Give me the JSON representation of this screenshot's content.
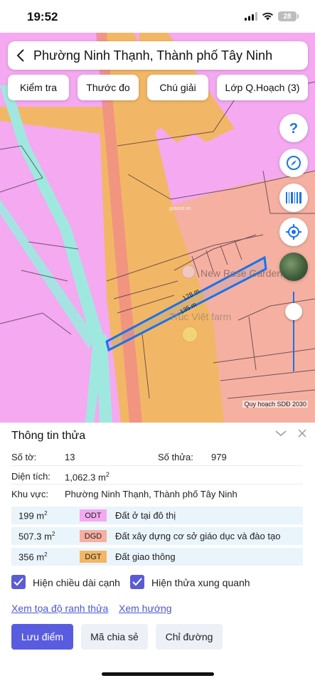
{
  "status": {
    "time": "19:52",
    "battery": "28"
  },
  "map": {
    "location_title": "Phường Ninh Thạnh, Thành phố Tây Ninh",
    "tools": [
      "Kiểm tra",
      "Thước đo",
      "Chú giải",
      "Lớp Q.Hoạch (3)"
    ],
    "labels": {
      "poi_1": "New Rose Garden",
      "poi_2": "Trúc Việt farm",
      "edge_1": "128 m",
      "edge_2": "135 m",
      "watermark": "guland.vn"
    },
    "credit": "Quy hoạch SDĐ 2030",
    "opacity_level": 0.85,
    "colors": {
      "residential": "#f4a9f0",
      "education": "#f5b0a1",
      "transport": "#f2b766",
      "water": "#9fe8e0",
      "parcel_outline": "#1a73e8"
    }
  },
  "parcel": {
    "title": "Thông tin thửa",
    "sheet_label": "Số tờ:",
    "sheet_value": "13",
    "parcel_label": "Số thửa:",
    "parcel_value": "979",
    "area_label": "Diện tích:",
    "area_value": "1,062.3 m",
    "area_unit_sup": "2",
    "region_label": "Khu vực:",
    "region_value": "Phường Ninh Thạnh, Thành phố Tây Ninh",
    "land_uses": [
      {
        "area": "199 m",
        "sup": "2",
        "code": "ODT",
        "name": "Đất ở tại đô thị",
        "color": "#f4a9f0"
      },
      {
        "area": "507.3 m",
        "sup": "2",
        "code": "DGD",
        "name": "Đất xây dựng cơ sở giáo dục và đào tạo",
        "color": "#f5b0a1"
      },
      {
        "area": "356 m",
        "sup": "2",
        "code": "DGT",
        "name": "Đất giao thông",
        "color": "#f2b766"
      }
    ],
    "options": {
      "show_edges": "Hiện chiều dài cạnh",
      "show_neighbors": "Hiện thửa xung quanh"
    },
    "links": {
      "coords": "Xem tọa độ ranh thửa",
      "direction": "Xem hướng"
    },
    "actions": {
      "save": "Lưu điểm",
      "share": "Mã chia sẻ",
      "route": "Chỉ đường"
    }
  }
}
